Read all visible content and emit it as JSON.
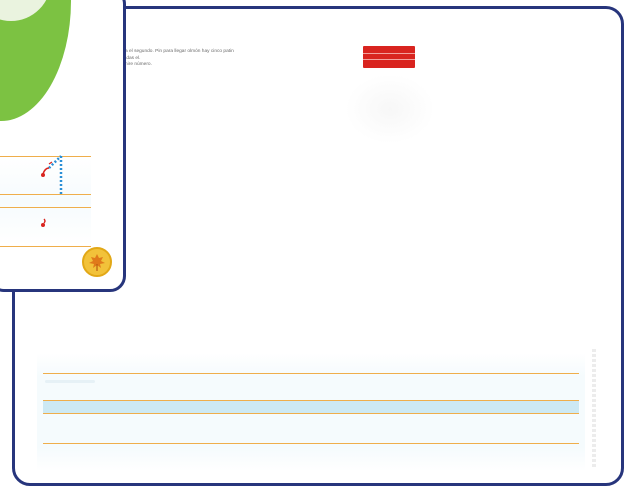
{
  "worksheet": {
    "instruction_lines": [
      "a a el segundo. Pin para llegar olmón hay cinco patin",
      "dadas el.",
      "amire número."
    ]
  },
  "colors": {
    "card_border": "#27357c",
    "accent_red": "#d9241f",
    "ruled_line": "#efae4b",
    "guide_strip": "#cde9f3",
    "cover_green": "#7cc242",
    "seal_yellow": "#f2c23a"
  },
  "icons": {
    "front_card": [
      "glasses-icon",
      "number-one-trace-icon",
      "start-dot-icon",
      "maple-leaf-icon"
    ]
  }
}
